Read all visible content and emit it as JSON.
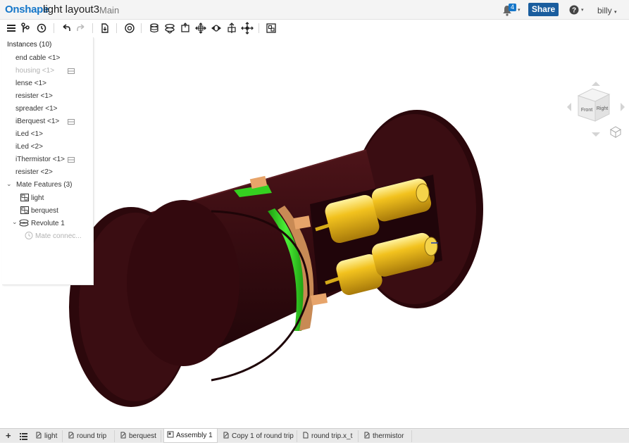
{
  "header": {
    "brand": "Onshape",
    "document_title": "light layout3",
    "branch": "Main",
    "notification_count": "4",
    "share_label": "Share",
    "help_icon": "question-circle-icon",
    "user_name": "billy"
  },
  "toolbar": {
    "items": [
      "menu-icon",
      "branch-icon",
      "history-icon",
      "undo-icon",
      "redo-icon",
      "insert-icon",
      "mate-connector-icon",
      "fastened-mate-icon",
      "revolute-mate-icon",
      "slider-mate-icon",
      "planar-mate-icon",
      "cylindrical-mate-icon",
      "pin-slot-mate-icon",
      "ball-mate-icon",
      "parallel-mate-icon",
      "group-icon"
    ]
  },
  "panel": {
    "header": "Instances (10)",
    "instances": [
      {
        "label": "end cable <1>",
        "suppressed": false,
        "flag": false
      },
      {
        "label": "housing <1>",
        "suppressed": true,
        "flag": true
      },
      {
        "label": "lense <1>",
        "suppressed": false,
        "flag": false
      },
      {
        "label": "resister <1>",
        "suppressed": false,
        "flag": false
      },
      {
        "label": "spreader <1>",
        "suppressed": false,
        "flag": false
      },
      {
        "label": "iBerquest <1>",
        "suppressed": false,
        "flag": true
      },
      {
        "label": "iLed <1>",
        "suppressed": false,
        "flag": false
      },
      {
        "label": "iLed <2>",
        "suppressed": false,
        "flag": false
      },
      {
        "label": "iThermistor <1>",
        "suppressed": false,
        "flag": true
      },
      {
        "label": "resister <2>",
        "suppressed": false,
        "flag": false
      }
    ],
    "mate_features_label": "Mate Features (3)",
    "mate_features": [
      {
        "label": "light",
        "icon": "group-icon"
      },
      {
        "label": "berquest",
        "icon": "group-icon"
      }
    ],
    "revolute_label": "Revolute 1",
    "revolute_child": "Mate connec..."
  },
  "view_cube": {
    "faces": [
      "Front",
      "Right"
    ]
  },
  "tabs": {
    "items": [
      {
        "label": "light",
        "icon": "part-studio-icon",
        "active": false
      },
      {
        "label": "round trip",
        "icon": "part-studio-icon",
        "active": false
      },
      {
        "label": "berquest",
        "icon": "part-studio-icon",
        "active": false
      },
      {
        "label": "Assembly 1",
        "icon": "assembly-icon",
        "active": true
      },
      {
        "label": "Copy 1 of round trip",
        "icon": "part-studio-icon",
        "active": false
      },
      {
        "label": "round trip.x_t",
        "icon": "file-icon",
        "active": false
      },
      {
        "label": "thermistor",
        "icon": "part-studio-icon",
        "active": false
      }
    ]
  },
  "colors": {
    "brand_blue": "#1677c9",
    "share_blue": "#1a5d9e",
    "housing_maroon": "#3a0d12",
    "ring_green": "#2fcf1f",
    "part_gold": "#e6b81a",
    "copper": "#c88a55"
  }
}
